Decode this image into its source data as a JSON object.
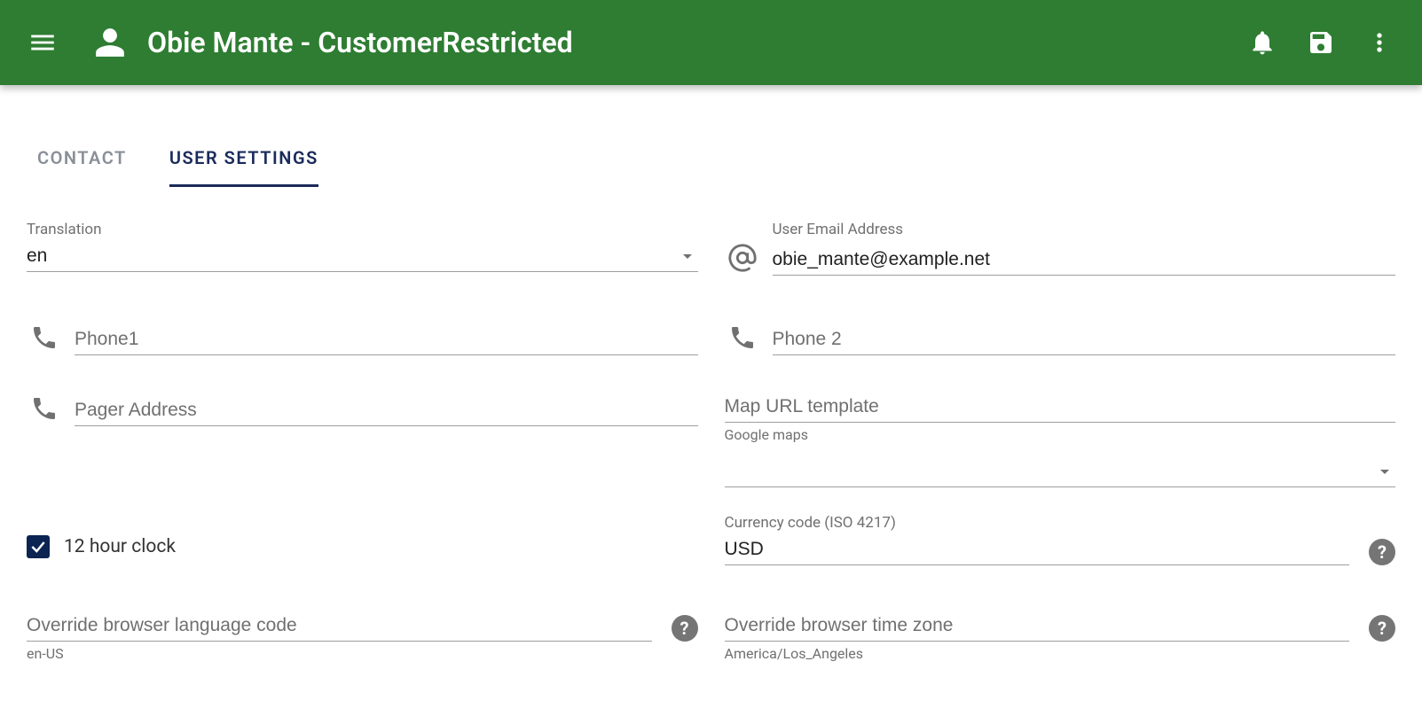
{
  "header": {
    "title": "Obie Mante - CustomerRestricted"
  },
  "tabs": {
    "contact": "CONTACT",
    "user_settings": "USER SETTINGS"
  },
  "fields": {
    "translation_label": "Translation",
    "translation_value": "en",
    "email_label": "User Email Address",
    "email_value": "obie_mante@example.net",
    "phone1_placeholder": "Phone1",
    "phone2_placeholder": "Phone 2",
    "pager_placeholder": "Pager Address",
    "map_url_placeholder": "Map URL template",
    "map_url_helper": "Google maps",
    "clock12_label": "12 hour clock",
    "currency_label": "Currency code (ISO 4217)",
    "currency_value": "USD",
    "override_lang_placeholder": "Override browser language code",
    "override_lang_helper": "en-US",
    "override_tz_placeholder": "Override browser time zone",
    "override_tz_helper": "America/Los_Angeles"
  }
}
